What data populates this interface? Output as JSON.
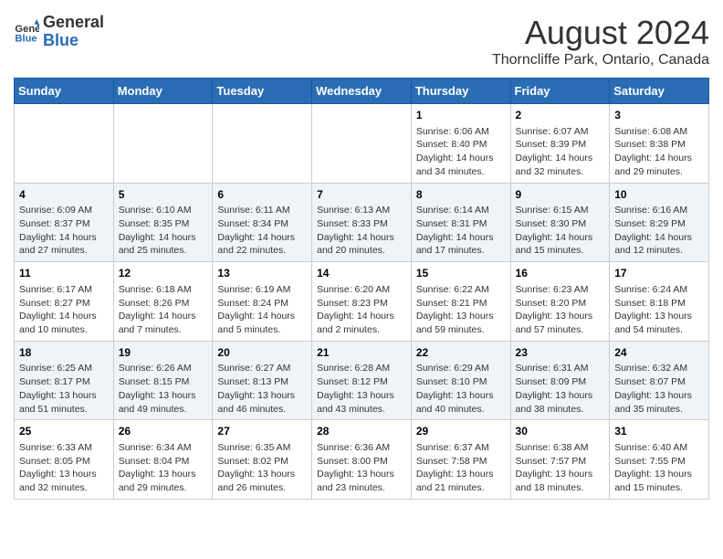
{
  "header": {
    "logo_general": "General",
    "logo_blue": "Blue",
    "month_title": "August 2024",
    "location": "Thorncliffe Park, Ontario, Canada"
  },
  "calendar": {
    "days_of_week": [
      "Sunday",
      "Monday",
      "Tuesday",
      "Wednesday",
      "Thursday",
      "Friday",
      "Saturday"
    ],
    "weeks": [
      [
        {
          "day": "",
          "info": ""
        },
        {
          "day": "",
          "info": ""
        },
        {
          "day": "",
          "info": ""
        },
        {
          "day": "",
          "info": ""
        },
        {
          "day": "1",
          "info": "Sunrise: 6:06 AM\nSunset: 8:40 PM\nDaylight: 14 hours and 34 minutes."
        },
        {
          "day": "2",
          "info": "Sunrise: 6:07 AM\nSunset: 8:39 PM\nDaylight: 14 hours and 32 minutes."
        },
        {
          "day": "3",
          "info": "Sunrise: 6:08 AM\nSunset: 8:38 PM\nDaylight: 14 hours and 29 minutes."
        }
      ],
      [
        {
          "day": "4",
          "info": "Sunrise: 6:09 AM\nSunset: 8:37 PM\nDaylight: 14 hours and 27 minutes."
        },
        {
          "day": "5",
          "info": "Sunrise: 6:10 AM\nSunset: 8:35 PM\nDaylight: 14 hours and 25 minutes."
        },
        {
          "day": "6",
          "info": "Sunrise: 6:11 AM\nSunset: 8:34 PM\nDaylight: 14 hours and 22 minutes."
        },
        {
          "day": "7",
          "info": "Sunrise: 6:13 AM\nSunset: 8:33 PM\nDaylight: 14 hours and 20 minutes."
        },
        {
          "day": "8",
          "info": "Sunrise: 6:14 AM\nSunset: 8:31 PM\nDaylight: 14 hours and 17 minutes."
        },
        {
          "day": "9",
          "info": "Sunrise: 6:15 AM\nSunset: 8:30 PM\nDaylight: 14 hours and 15 minutes."
        },
        {
          "day": "10",
          "info": "Sunrise: 6:16 AM\nSunset: 8:29 PM\nDaylight: 14 hours and 12 minutes."
        }
      ],
      [
        {
          "day": "11",
          "info": "Sunrise: 6:17 AM\nSunset: 8:27 PM\nDaylight: 14 hours and 10 minutes."
        },
        {
          "day": "12",
          "info": "Sunrise: 6:18 AM\nSunset: 8:26 PM\nDaylight: 14 hours and 7 minutes."
        },
        {
          "day": "13",
          "info": "Sunrise: 6:19 AM\nSunset: 8:24 PM\nDaylight: 14 hours and 5 minutes."
        },
        {
          "day": "14",
          "info": "Sunrise: 6:20 AM\nSunset: 8:23 PM\nDaylight: 14 hours and 2 minutes."
        },
        {
          "day": "15",
          "info": "Sunrise: 6:22 AM\nSunset: 8:21 PM\nDaylight: 13 hours and 59 minutes."
        },
        {
          "day": "16",
          "info": "Sunrise: 6:23 AM\nSunset: 8:20 PM\nDaylight: 13 hours and 57 minutes."
        },
        {
          "day": "17",
          "info": "Sunrise: 6:24 AM\nSunset: 8:18 PM\nDaylight: 13 hours and 54 minutes."
        }
      ],
      [
        {
          "day": "18",
          "info": "Sunrise: 6:25 AM\nSunset: 8:17 PM\nDaylight: 13 hours and 51 minutes."
        },
        {
          "day": "19",
          "info": "Sunrise: 6:26 AM\nSunset: 8:15 PM\nDaylight: 13 hours and 49 minutes."
        },
        {
          "day": "20",
          "info": "Sunrise: 6:27 AM\nSunset: 8:13 PM\nDaylight: 13 hours and 46 minutes."
        },
        {
          "day": "21",
          "info": "Sunrise: 6:28 AM\nSunset: 8:12 PM\nDaylight: 13 hours and 43 minutes."
        },
        {
          "day": "22",
          "info": "Sunrise: 6:29 AM\nSunset: 8:10 PM\nDaylight: 13 hours and 40 minutes."
        },
        {
          "day": "23",
          "info": "Sunrise: 6:31 AM\nSunset: 8:09 PM\nDaylight: 13 hours and 38 minutes."
        },
        {
          "day": "24",
          "info": "Sunrise: 6:32 AM\nSunset: 8:07 PM\nDaylight: 13 hours and 35 minutes."
        }
      ],
      [
        {
          "day": "25",
          "info": "Sunrise: 6:33 AM\nSunset: 8:05 PM\nDaylight: 13 hours and 32 minutes."
        },
        {
          "day": "26",
          "info": "Sunrise: 6:34 AM\nSunset: 8:04 PM\nDaylight: 13 hours and 29 minutes."
        },
        {
          "day": "27",
          "info": "Sunrise: 6:35 AM\nSunset: 8:02 PM\nDaylight: 13 hours and 26 minutes."
        },
        {
          "day": "28",
          "info": "Sunrise: 6:36 AM\nSunset: 8:00 PM\nDaylight: 13 hours and 23 minutes."
        },
        {
          "day": "29",
          "info": "Sunrise: 6:37 AM\nSunset: 7:58 PM\nDaylight: 13 hours and 21 minutes."
        },
        {
          "day": "30",
          "info": "Sunrise: 6:38 AM\nSunset: 7:57 PM\nDaylight: 13 hours and 18 minutes."
        },
        {
          "day": "31",
          "info": "Sunrise: 6:40 AM\nSunset: 7:55 PM\nDaylight: 13 hours and 15 minutes."
        }
      ]
    ]
  }
}
